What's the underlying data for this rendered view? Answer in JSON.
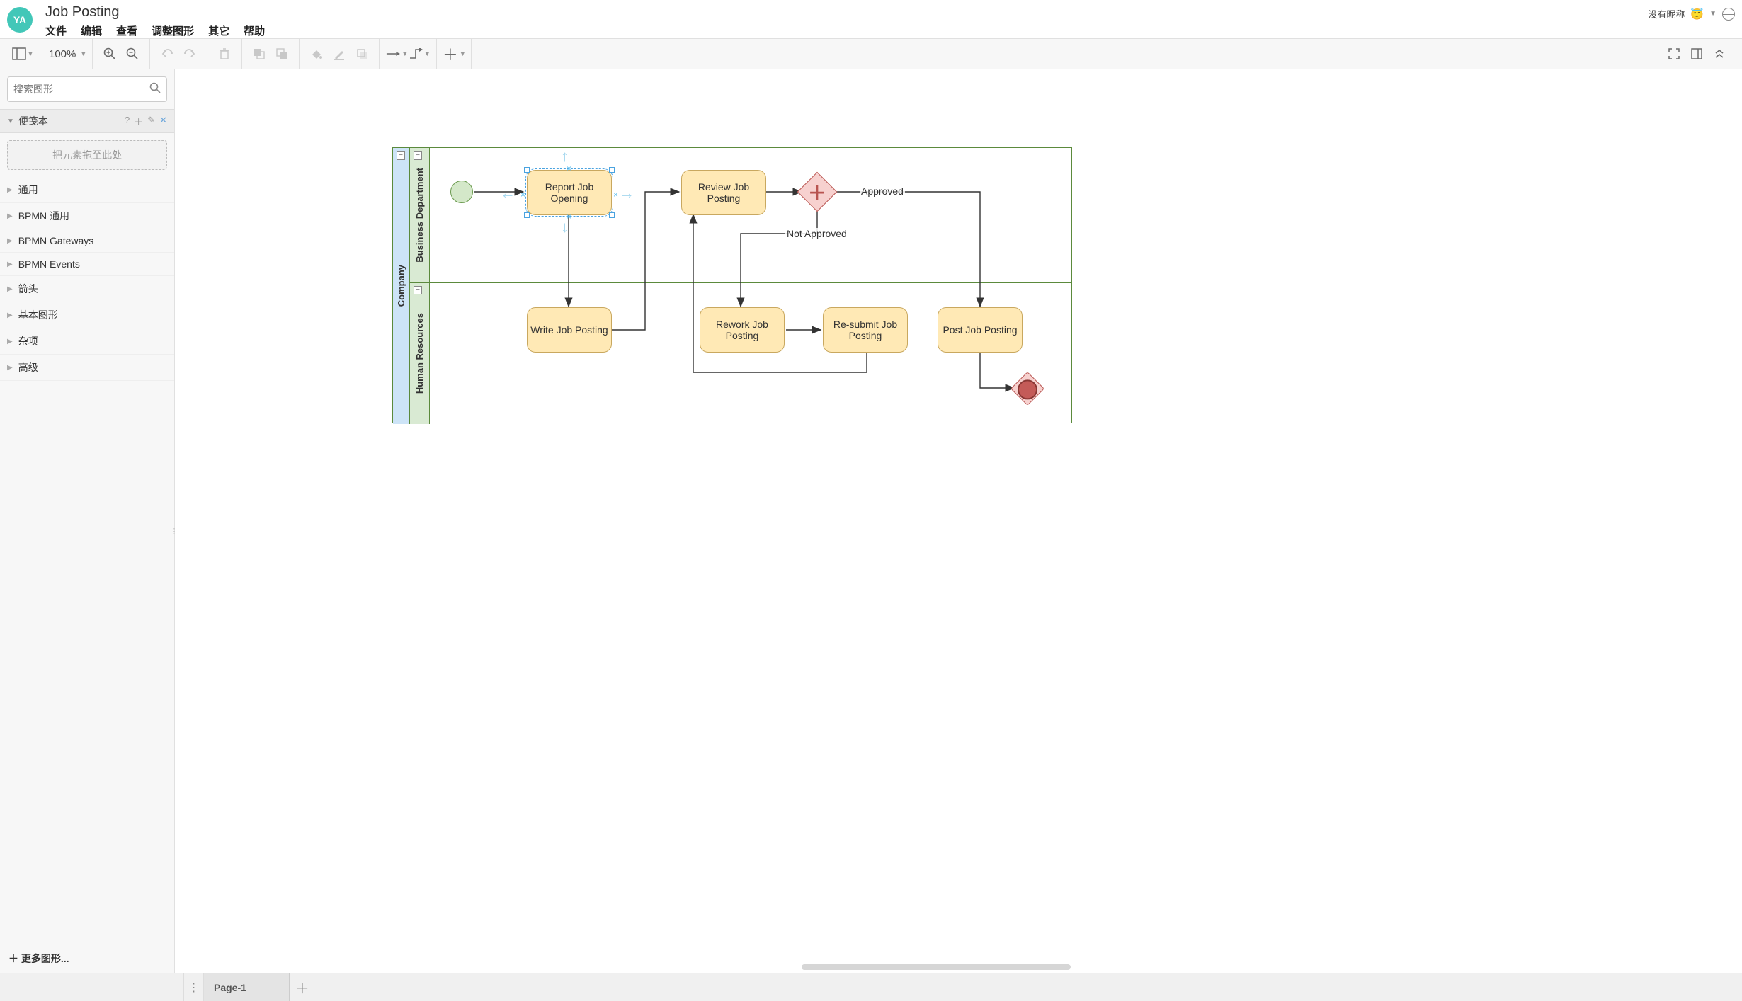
{
  "header": {
    "logo_text": "YA",
    "doc_title": "Job Posting",
    "menu": [
      "文件",
      "编辑",
      "查看",
      "调整图形",
      "其它",
      "帮助"
    ],
    "user_label": "没有昵称",
    "user_emoji": "😇"
  },
  "toolbar": {
    "zoom": "100%"
  },
  "sidebar": {
    "search_placeholder": "搜索图形",
    "scratchpad_title": "便笺本",
    "dropzone_text": "把元素拖至此处",
    "categories": [
      "通用",
      "BPMN 通用",
      "BPMN Gateways",
      "BPMN Events",
      "箭头",
      "基本图形",
      "杂项",
      "高级"
    ],
    "more_shapes": "＋ 更多图形..."
  },
  "diagram": {
    "pool": "Company",
    "lanes": [
      "Business Department",
      "Human Resources"
    ],
    "tasks": {
      "report": "Report Job Opening",
      "review": "Review Job Posting",
      "write": "Write Job Posting",
      "rework": "Rework Job Posting",
      "resubmit": "Re-submit Job Posting",
      "post": "Post Job Posting"
    },
    "labels": {
      "approved": "Approved",
      "not_approved": "Not Approved"
    }
  },
  "tabs": {
    "page1": "Page-1"
  }
}
